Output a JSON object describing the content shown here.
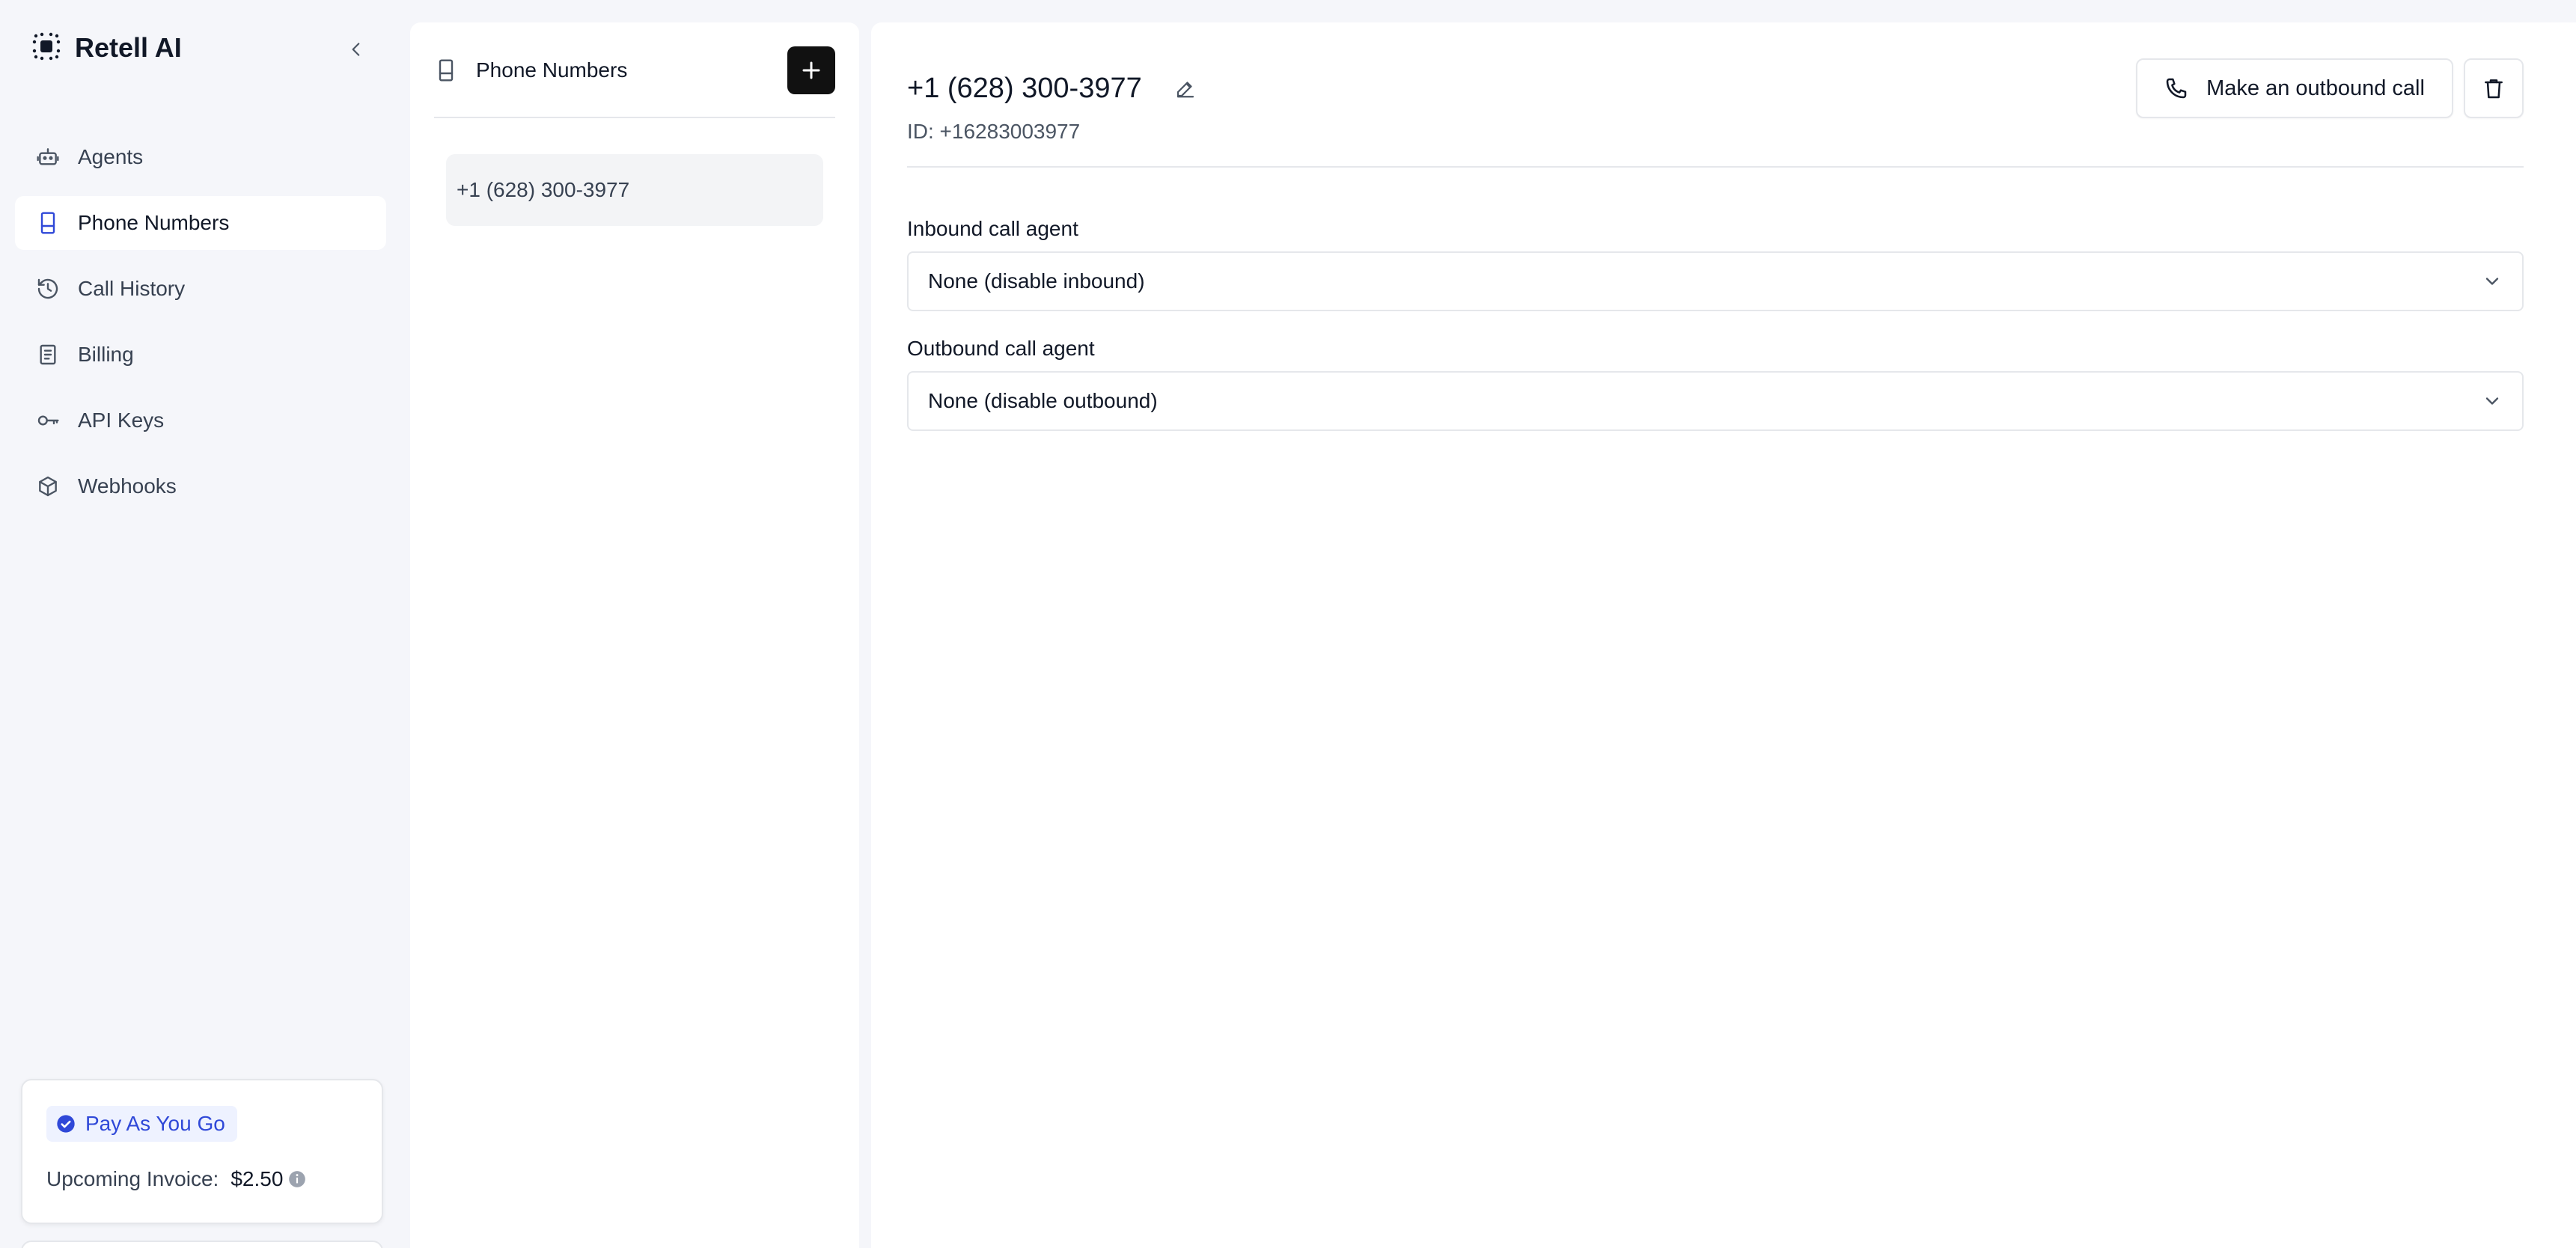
{
  "app": {
    "name": "Retell AI"
  },
  "sidebar": {
    "items": [
      {
        "label": "Agents",
        "icon": "robot-icon"
      },
      {
        "label": "Phone Numbers",
        "icon": "phone-number-icon",
        "active": true
      },
      {
        "label": "Call History",
        "icon": "history-icon"
      },
      {
        "label": "Billing",
        "icon": "receipt-icon"
      },
      {
        "label": "API Keys",
        "icon": "key-icon"
      },
      {
        "label": "Webhooks",
        "icon": "webhook-icon"
      }
    ],
    "plan": {
      "badge": "Pay As You Go",
      "invoice_label": "Upcoming Invoice:",
      "invoice_amount": "$2.50"
    }
  },
  "phone_list": {
    "title": "Phone Numbers",
    "items": [
      "+1 (628) 300-3977"
    ]
  },
  "detail": {
    "title": "+1 (628) 300-3977",
    "id_line": "ID: +16283003977",
    "outbound_button": "Make an outbound call",
    "inbound_label": "Inbound call agent",
    "inbound_value": "None (disable inbound)",
    "outbound_label": "Outbound call agent",
    "outbound_value": "None (disable outbound)"
  },
  "colors": {
    "accent": "#2f48d8",
    "accent_bg": "#eef2ff",
    "add_button": "#111111",
    "sidebar_bg": "#f5f6fa"
  }
}
